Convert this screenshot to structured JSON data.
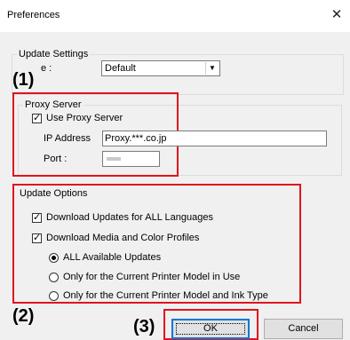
{
  "window": {
    "title": "Preferences",
    "close_glyph": "✕"
  },
  "update_settings": {
    "legend": "Update Settings",
    "mode_label": "e :",
    "mode_value": "Default",
    "combo_arrow": "▼"
  },
  "proxy": {
    "legend": "Proxy Server",
    "use_proxy_label": "Use Proxy Server",
    "use_proxy_checked": true,
    "ip_label": "IP Address",
    "ip_value": "Proxy.***.co.jp",
    "port_label": "Port :"
  },
  "update_options": {
    "legend": "Update Options",
    "download_all_languages": {
      "label": "Download Updates for ALL Languages",
      "checked": true
    },
    "download_media_profiles": {
      "label": "Download Media and Color Profiles",
      "checked": true
    },
    "radios": [
      {
        "label": "ALL Available Updates",
        "selected": true
      },
      {
        "label": "Only for the Current Printer Model in Use",
        "selected": false
      },
      {
        "label": "Only for the Current Printer Model and Ink Type",
        "selected": false
      }
    ]
  },
  "buttons": {
    "ok_label": "OK",
    "cancel_label": "Cancel"
  },
  "annotations": {
    "a1": "(1)",
    "a2": "(2)",
    "a3": "(3)"
  },
  "colors": {
    "highlight_red": "#e0141e",
    "focus_blue": "#0078d7"
  }
}
